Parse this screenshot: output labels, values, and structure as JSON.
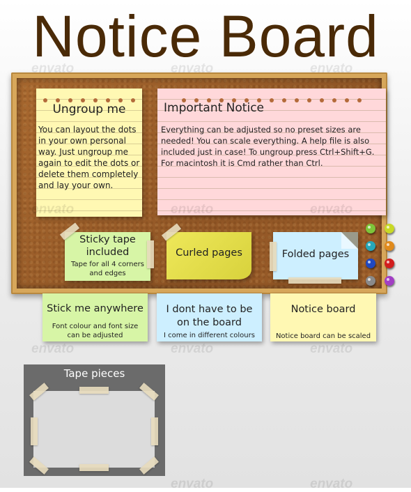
{
  "page": {
    "title": "Notice Board",
    "watermark": "envato"
  },
  "notes": {
    "ungroup": {
      "heading": "Ungroup me",
      "body": "You can layout the dots in your own personal way. Just ungroup me again to edit the dots or delete them completely and lay your own."
    },
    "important": {
      "heading": "Important Notice",
      "body": "Everything can be adjusted so no preset sizes are needed! You can scale everything. A help file is also included just in case! To ungroup press Ctrl+Shift+G. For macintosh it is Cmd rather than Ctrl."
    },
    "sticky_tape": {
      "heading": "Sticky tape included",
      "sub": "Tape for all 4 corners and edges"
    },
    "curled": {
      "heading": "Curled pages"
    },
    "folded": {
      "heading": "Folded pages"
    },
    "stick_anywhere": {
      "heading": "Stick me anywhere",
      "sub": "Font colour and font size can be adjusted"
    },
    "not_on_board": {
      "heading": "I dont have to be on the board",
      "sub": "I come in different colours"
    },
    "notice_board": {
      "heading": "Notice board",
      "sub": "Notice board can be scaled"
    }
  },
  "tape_pieces": {
    "label": "Tape pieces"
  },
  "pins": [
    {
      "name": "green-pin",
      "color": "#7ec53a"
    },
    {
      "name": "lime-pin",
      "color": "#c8d926"
    },
    {
      "name": "teal-pin",
      "color": "#27a7b8"
    },
    {
      "name": "orange-pin",
      "color": "#e08a1c"
    },
    {
      "name": "blue-pin",
      "color": "#2048c0"
    },
    {
      "name": "red-pin",
      "color": "#d21e1e"
    },
    {
      "name": "grey-pin",
      "color": "#8a8a8a"
    },
    {
      "name": "purple-pin",
      "color": "#a23fc4"
    }
  ],
  "colors": {
    "title": "#4a2a07",
    "yellow_note": "#fff8b3",
    "pink_note": "#ffd8da",
    "green_note": "#d7f5a6",
    "blue_note": "#cdefff",
    "lime_note": "#eee85a"
  }
}
